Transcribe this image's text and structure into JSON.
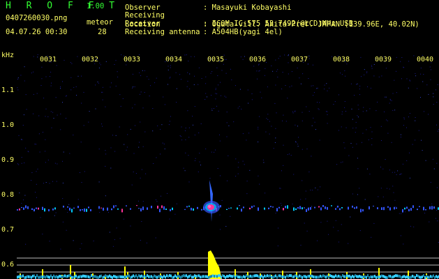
{
  "header": {
    "logo": "H R O F F T",
    "version": "1.00",
    "filename": "0407260030.png",
    "timestamp": "04.07.26 00:30",
    "meteor_label": "meteor",
    "meteor_count": "28"
  },
  "info": [
    {
      "key": "Observer",
      "value": ": Masayuki Kobayashi"
    },
    {
      "key": "Receiving Location",
      "value": ": Ogata-vill. Akita-Pref. JAPAN (139.96E, 40.02N)"
    },
    {
      "key": "Receiver",
      "value": ": ICOM IC-575 53.7492(@LCD)MHz USB"
    },
    {
      "key": "Receiving antenna",
      "value": ": A504HB(yagi 4el)"
    }
  ],
  "axis": {
    "unit": "kHz",
    "y_ticks": [
      "1.1",
      "1.0",
      "0.9",
      "0.8",
      "0.7",
      "0.6"
    ],
    "x_ticks": [
      "0031",
      "0032",
      "0033",
      "0034",
      "0035",
      "0036",
      "0037",
      "0038",
      "0039",
      "0040"
    ]
  },
  "colors": {
    "text": "#ffff66",
    "logo": "#33ff33",
    "background": "#000000",
    "noise": "#1a1a8c",
    "echo": "#ff3399",
    "histogram_count": "#ffff00",
    "histogram_baseline": "#33ccff"
  }
}
